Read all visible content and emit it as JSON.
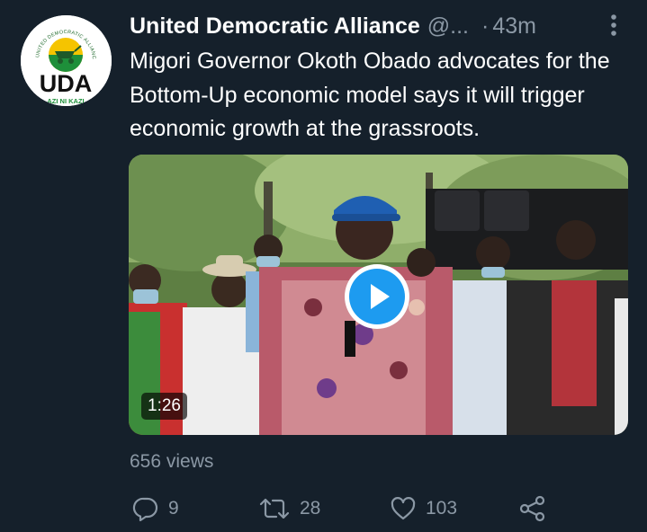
{
  "tweet": {
    "author_name": "United Democratic Alliance",
    "author_handle": "@...",
    "separator": "·",
    "time_ago": "43m",
    "text": "Migori Governor Okoth Obado advocates for the Bottom-Up economic model says it will trigger economic growth at the grassroots.",
    "avatar": {
      "logo_text": "UDA",
      "arc_text": "UNITED DEMOCRATIC ALLIANCE",
      "bottom_text": "AZI NI KAZI"
    },
    "video": {
      "duration": "1:26"
    },
    "views": "656 views",
    "actions": {
      "replies": "9",
      "retweets": "28",
      "likes": "103"
    }
  },
  "colors": {
    "background": "#15202b",
    "primary_text": "#ffffff",
    "secondary_text": "#8b98a5",
    "accent": "#1d9bf0"
  },
  "icons": [
    "more-icon",
    "reply-icon",
    "retweet-icon",
    "like-icon",
    "share-icon",
    "play-icon"
  ]
}
